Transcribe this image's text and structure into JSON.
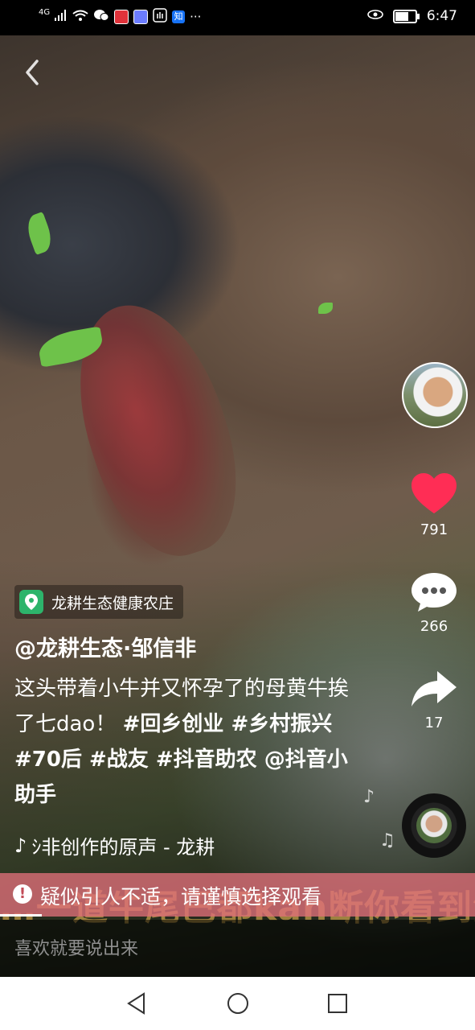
{
  "status_bar": {
    "network": "4G",
    "time": "6:47",
    "more": "···",
    "app_icons": [
      {
        "name": "signal-icon"
      },
      {
        "name": "wifi-icon"
      },
      {
        "name": "wechat-icon"
      },
      {
        "name": "red-app-icon",
        "color": "#e0323a"
      },
      {
        "name": "music-app-icon",
        "color": "#6b7cff"
      },
      {
        "name": "hand-app-icon"
      },
      {
        "name": "zhihu-icon",
        "color": "#1772f6",
        "label": "知"
      }
    ],
    "battery_level": 0.75
  },
  "video": {
    "location": "龙耕生态健康农庄",
    "author": "@龙耕生态·邹信非",
    "caption_plain": "这头带着小牛并又怀孕了的母黄牛挨了七dao！",
    "caption_tags": "#回乡创业 #乡村振兴 #70后 #战友 #抖音助农 @抖音小助手",
    "music": "ｼ非创作的原声 - 龙耕"
  },
  "actions": {
    "likes": "791",
    "comments": "266",
    "shares": "17"
  },
  "warning": {
    "text": "疑似引人不适，请谨慎选择观看"
  },
  "subtitle_burned": "…一道牛尾巴都kan断你看到没有",
  "comment_box": {
    "placeholder": "喜欢就要说出来"
  },
  "colors": {
    "like": "#ff2d55",
    "location_icon": "#2db46b",
    "warning_bg": "#e06f7a"
  }
}
